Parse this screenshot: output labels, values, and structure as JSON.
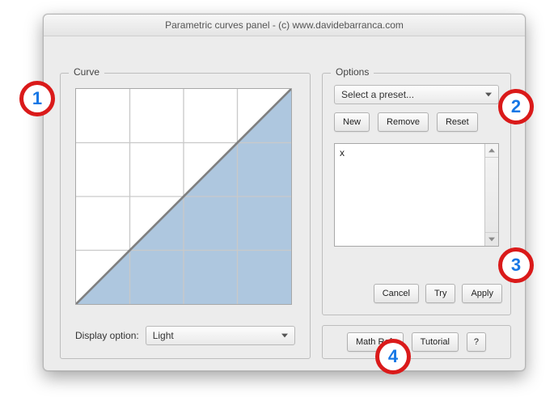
{
  "window": {
    "title": "Parametric curves panel - (c) www.davidebarranca.com"
  },
  "curve_panel": {
    "legend": "Curve",
    "display_label": "Display option:",
    "display_value": "Light",
    "grid_divisions": 4
  },
  "options_panel": {
    "legend": "Options",
    "preset_value": "Select a preset...",
    "buttons": {
      "new": "New",
      "remove": "Remove",
      "reset": "Reset",
      "cancel": "Cancel",
      "try": "Try",
      "apply": "Apply"
    },
    "formula_value": "x"
  },
  "help_panel": {
    "math_ref": "Math Ref.",
    "tutorial": "Tutorial",
    "help": "?"
  },
  "annotations": {
    "n1": "1",
    "n2": "2",
    "n3": "3",
    "n4": "4"
  },
  "chart_data": {
    "type": "line",
    "title": "",
    "xlabel": "",
    "ylabel": "",
    "xlim": [
      0,
      1
    ],
    "ylim": [
      0,
      1
    ],
    "x": [
      0,
      0.25,
      0.5,
      0.75,
      1
    ],
    "values": [
      0,
      0.25,
      0.5,
      0.75,
      1
    ],
    "fill_below": true,
    "fill_color": "#aec7df",
    "line_color": "#808080",
    "grid": true
  }
}
